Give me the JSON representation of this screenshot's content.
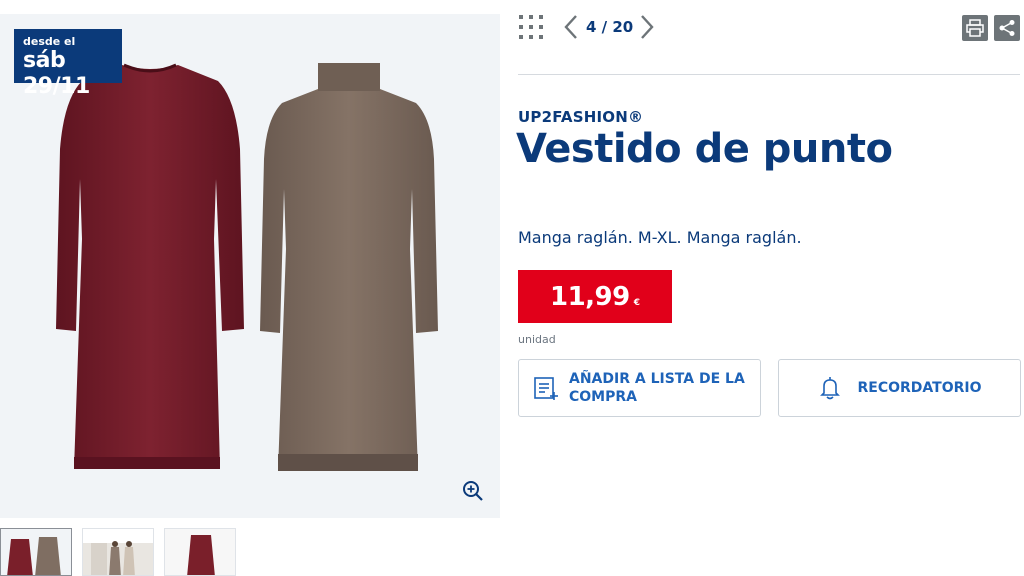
{
  "badge": {
    "small": "desde el",
    "big": "sáb 29/11"
  },
  "navigation": {
    "counter": "4 / 20"
  },
  "product": {
    "brand": "UP2FASHION®",
    "title": "Vestido de punto",
    "description": "Manga raglán. M-XL. Manga raglán.",
    "price": "11,99",
    "currency": "€",
    "unit": "unidad"
  },
  "actions": {
    "add_to_list": "AÑADIR A LISTA DE LA COMPRA",
    "reminder": "RECORDATORIO"
  },
  "colors": {
    "brand_blue": "#0b3a7a",
    "link_blue": "#1e63b8",
    "price_red": "#e1001a",
    "dress_burgundy": "#7a1f2a",
    "dress_brown": "#7a6a5e"
  },
  "icons": [
    "grid-icon",
    "chevron-left-icon",
    "chevron-right-icon",
    "print-icon",
    "share-icon",
    "zoom-in-icon",
    "shopping-list-icon",
    "bell-icon"
  ]
}
